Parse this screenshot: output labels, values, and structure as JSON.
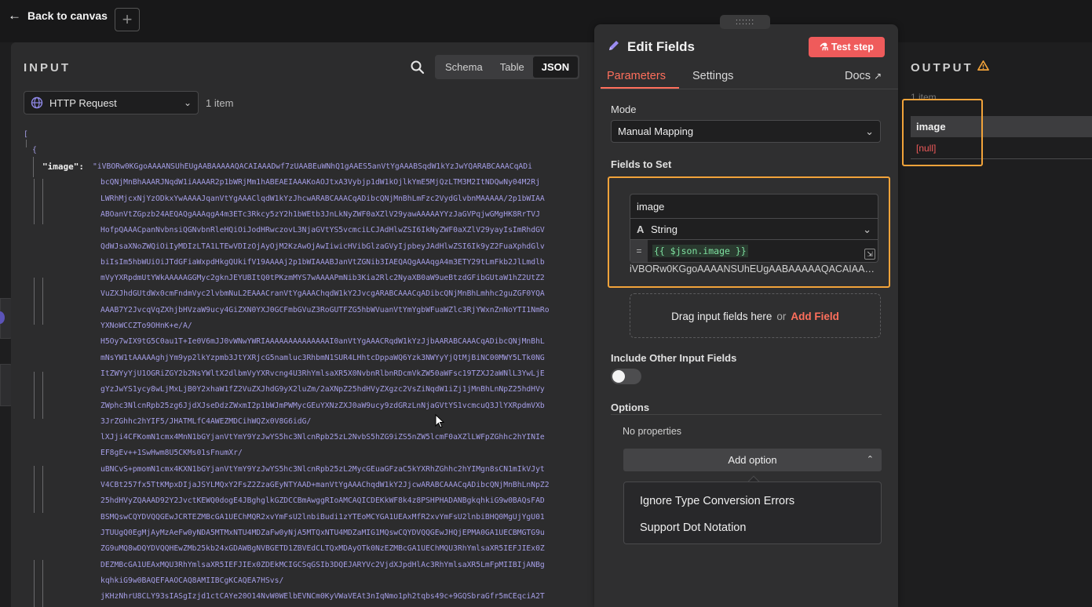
{
  "topbar": {
    "back_label": "Back to canvas",
    "plus_label": "+",
    "drag_handle_label": "::::::"
  },
  "input": {
    "title": "INPUT",
    "tabs": [
      {
        "label": "Schema"
      },
      {
        "label": "Table"
      },
      {
        "label": "JSON"
      }
    ],
    "node_select": {
      "value": "HTTP Request"
    },
    "item_count": "1 item",
    "json": {
      "open_bracket": "[",
      "open_brace": "{",
      "key": "\"image\":",
      "lines": [
        "\"iVBORw0KGgoAAAANSUhEUgAABAAAAAQACAIAAADwf7zUAABEuWNhQ1gAAES5anVtYgAAABSqdW1kYzJwYQARABCAAACqADi",
        "bcQNjMnBhAAARJNqdW1iAAAAR2p1bWRjMm1hABEAEIAAAKoAOJtxA3Vybjp1dW1kOjlkYmE5MjQzLTM3M2ItNDQwNy04M2Rj",
        "LWRhMjcxNjYzODkxYwAAAAJqanVtYgAAAClqdW1kYzJhcwARABCAAACqADibcQNjMnBhLmFzc2VydGlvbnMAAAAA/2p1bWIAA",
        "ABOanVtZGpzb24AEQAQgAAAqgA4m3ETc3Rkcy5zY2h1bWEtb3JnLkNyZWF0aXZlV29yawAAAAAYYzJaGVPqjwGMgHK8RrTVJ",
        "HofpQAAACpanNvbnsiQGNvbnRleHQiOiJodHRwczovL3NjaGVtYS5vcmciLCJAdHlwZSI6IkNyZWF0aXZlV29yayIsImRhdGV",
        "QdWJsaXNoZWQiOiIyMDIzLTA1LTEwVDIzOjAyOjM2KzAwOjAwIiwicHVibGlzaGVyIjpbeyJAdHlwZSI6Ik9yZ2FuaXphdGlv",
        "biIsIm5hbWUiOiJTdGFiaWxpdHkgQUkifV19AAAAj2p1bWIAAABJanVtZGNib3IAEQAQgAAAqgA4m3ETY29tLmFkb2JlLmdlb",
        "mVyYXRpdmUtYWkAAAAAGGMyc2gknJEYUBItQ0tPKzmMYS7wAAAAPmNib3Kia2Rlc2NyaXB0aW9ueBtzdGFibGUtaW1hZ2UtZ2",
        "VuZXJhdGUtdWx0cmFndmVyc2lvbmNuL2EAAACranVtYgAAAChqdW1kY2JvcgARABCAAACqADibcQNjMnBhLmhhc2guZGF0YQA",
        "AAAB7Y2JvcqVqZXhjbHVzaW9ucy4GiZXN0YXJ0GCFmbGVuZ3RoGUTFZG5hbWVuanVtYmYgbWFuaWZlc3RjYWxnZnNoYTI1NmRo",
        "YXNoWCCZTo9OHnK+e/A/",
        "H5Oy7wIX9tG5C0au1T+Ie0V6mJJ0vWNwYWRIAAAAAAAAAAAAAAI0anVtYgAAACRqdW1kYzJjbAARABCAAACqADibcQNjMnBhL",
        "mNsYW1tAAAAAghjYm9yp2lkYzpmb3JtYXRjcG5namluc3RhbmN1SUR4LHhtcDppaWQ6Yzk3NWYyYjQtMjBiNC00MWY5LTk0NG",
        "ItZWYyYjU1OGRiZGY2b2NsYWltX2dlbmVyYXRvcng4U3RhYmlsaXR5X0NvbnRlbnRDcmVkZW50aWFsc19TZXJ2aWNlL3YwLjE",
        "gYzJwYS1ycy8wLjMxLjB0Y2xhaW1fZ2VuZXJhdG9yX2luZm/2aXNpZ25hdHVyZXgzc2VsZiNqdW1iZj1jMnBhLnNpZ25hdHVy",
        "ZWphc3NlcnRpb25zg6JjdXJseDdzZWxmI2p1bWJmPWMycGEuYXNzZXJ0aW9ucy9zdGRzLnNjaGVtYS1vcmcuQ3JlYXRpdmVXb",
        "3JrZGhhc2hYIF5/JHATMLfC4AWEZMDCihWQZx0V8G6idG/",
        "lXJji4CFKomN1cmx4MnN1bGYjanVtYmY9YzJwYS5hc3NlcnRpb25zL2NvbS5hZG9iZS5nZW5lcmF0aXZlLWFpZGhhc2hYINIe",
        "EF8gEv++1SwHwm8U5CKMs01sFnumXr/",
        "uBNCvS+pmomN1cmx4KXN1bGYjanVtYmY9YzJwYS5hc3NlcnRpb25zL2MycGEuaGFzaC5kYXRhZGhhc2hYIMgn8sCN1mIkVJyt",
        "V4CBt257fx5TtKMpxDIjaJSYLMQxY2FsZ2ZzaGEyNTYAAD+manVtYgAAAChqdW1kY2JjcwARABCAAACqADibcQNjMnBhLnNpZ2",
        "25hdHVyZQAAAD92Y2JvctKEWQ0dogE4JBghglkGZDCCBmAwggRIoAMCAQICDEKkWF8k4z8PSHPHADANBgkqhkiG9w0BAQsFAD",
        "BSMQswCQYDVQQGEwJCRTEZMBcGA1UEChMQR2xvYmFsU2lnbiBudi1zYTEoMCYGA1UEAxMfR2xvYmFsU2lnbiBHQ0MgUjYgU01",
        "JTUUgQ0EgMjAyMzAeFw0yNDA5MTMxNTU4MDZaFw0yNjA5MTQxNTU4MDZaMIG1MQswCQYDVQQGEwJHQjEPMA0GA1UECBMGTG9u",
        "ZG9uMQ8wDQYDVQQHEwZMb25kb24xGDAWBgNVBGETD1ZBVEdCLTQxMDAyOTk0NzEZMBcGA1UEChMQU3RhYmlsaXR5IEFJIEx0Z",
        "DEZMBcGA1UEAxMQU3RhYmlsaXR5IEFJIEx0ZDEkMCIGCSqGSIb3DQEJARYVc2VjdXJpdHlAc3RhYmlsaXR5LmFpMIIBIjANBg",
        "kqhkiG9w0BAQEFAAOCAQ8AMIIBCgKCAQEA7HSvs/",
        "jKHzNhrU8CLY93sIASgIzjd1ctCAYe20O14NvW0WElbEVNCm0KyVWaVEAt3nIqNmo1ph2tqbs49c+9GQSbraGfr5mCEqciA2T"
      ]
    }
  },
  "edit": {
    "title": "Edit Fields",
    "test_step_label": "Test step",
    "tabs": {
      "parameters": "Parameters",
      "settings": "Settings",
      "docs": "Docs"
    },
    "mode_label": "Mode",
    "mode_value": "Manual Mapping",
    "fields_label": "Fields to Set",
    "field": {
      "name": "image",
      "type_icon": "A",
      "type": "String",
      "eq": "=",
      "expression": "{{ $json.image }}",
      "preview": "iVBORw0KGgoAAAANSUhEUgAABAAAAAQACAIAAADwf7zUAABEuWNhQ1gAAES5anVtYgAAABSqdW1kYzJwYQARABCAAACqADi"
    },
    "drop_text": "Drag input fields here",
    "drop_or": "or",
    "add_field_label": "Add Field",
    "include_label": "Include Other Input Fields",
    "options_label": "Options",
    "no_props": "No properties",
    "add_option_label": "Add option",
    "menu_items": [
      {
        "label": "Ignore Type Conversion Errors"
      },
      {
        "label": "Support Dot Notation"
      }
    ]
  },
  "output": {
    "title": "OUTPUT",
    "item_count": "1 item",
    "column": "image",
    "value": "[null]"
  },
  "colors": {
    "accent": "#ff6f5c",
    "highlight": "#f2a33a",
    "json_string": "#a59ee6",
    "expression": "#7ee0a0"
  }
}
